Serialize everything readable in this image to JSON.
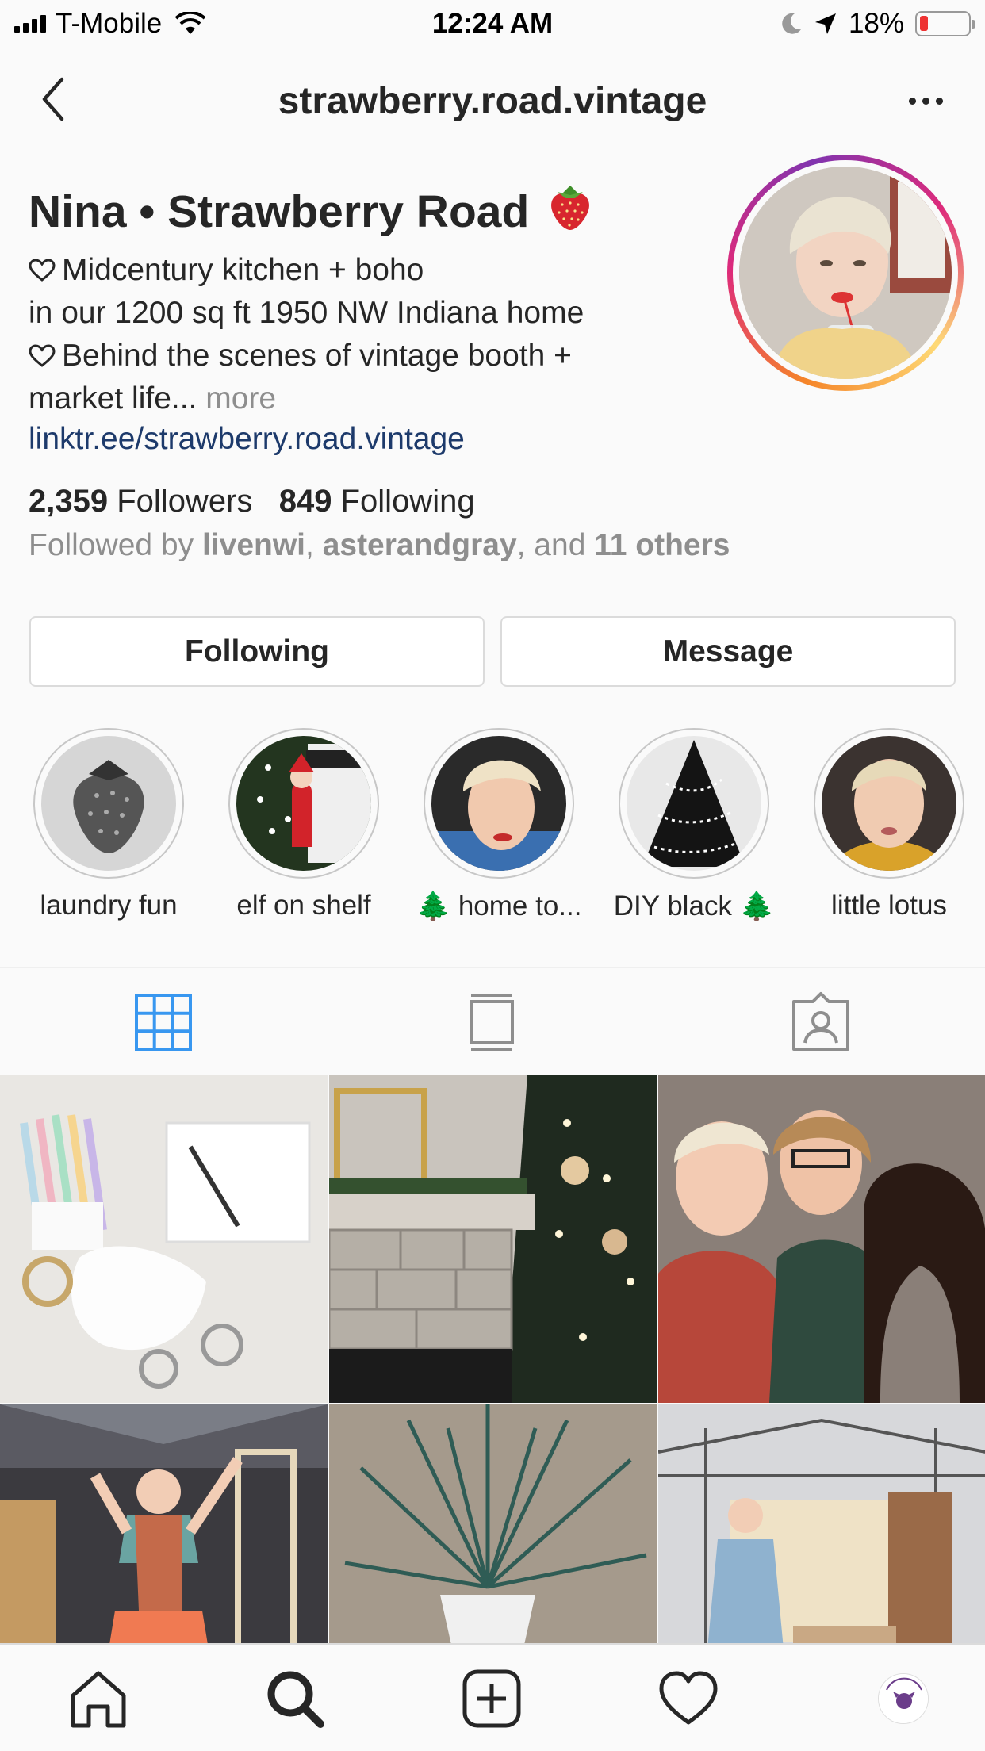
{
  "status_bar": {
    "carrier": "T-Mobile",
    "time": "12:24 AM",
    "battery_percent": "18%",
    "battery_level": 0.18
  },
  "nav": {
    "username": "strawberry.road.vintage",
    "back_icon": "chevron-left-icon",
    "more_icon": "ellipsis-icon"
  },
  "profile": {
    "display_name": "Nina • Strawberry Road",
    "bio_line1": "Midcentury kitchen + boho",
    "bio_line2": "in our 1200 sq ft 1950 NW Indiana home",
    "bio_line3": "Behind the scenes of vintage booth +",
    "bio_line4": "market life...",
    "bio_more": "more",
    "link": "linktr.ee/strawberry.road.vintage",
    "followers_count": "2,359",
    "followers_label": "Followers",
    "following_count": "849",
    "following_label": "Following",
    "followed_by_prefix": "Followed by",
    "followed_by_user1": "livenwi",
    "followed_by_user2": "asterandgray",
    "followed_by_and": ", and",
    "followed_by_others": "11 others"
  },
  "buttons": {
    "following": "Following",
    "message": "Message"
  },
  "highlights": [
    {
      "label": "laundry fun"
    },
    {
      "label": "elf on shelf"
    },
    {
      "label": "🌲 home to..."
    },
    {
      "label": "DIY black 🌲"
    },
    {
      "label": "little lotus"
    }
  ],
  "tabs": {
    "active": "grid",
    "active_color": "#3897f0",
    "items": [
      "grid-icon",
      "feed-icon",
      "tagged-icon"
    ]
  },
  "bottom_bar": {
    "items": [
      "home-icon",
      "search-icon",
      "new-post-icon",
      "activity-heart-icon",
      "profile-avatar"
    ]
  },
  "colors": {
    "text": "#262626",
    "secondary": "#8e8e8e",
    "link": "#1d3a6b"
  }
}
